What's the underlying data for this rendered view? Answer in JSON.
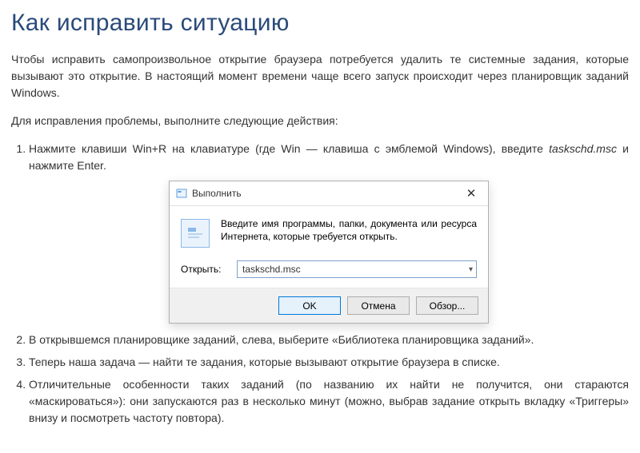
{
  "heading": "Как исправить ситуацию",
  "intro": "Чтобы исправить самопроизвольное открытие браузера потребуется удалить те системные задания, которые вызывают это открытие. В настоящий момент времени чаще всего запуск происходит через планировщик заданий Windows.",
  "lead": "Для исправления проблемы, выполните следующие действия:",
  "steps": {
    "s1a": "Нажмите клавиши Win+R на клавиатуре (где Win — клавиша с эмблемой Windows), введите ",
    "s1cmd": "taskschd.msc",
    "s1b": " и нажмите Enter.",
    "s2": "В открывшемся планировщике заданий, слева, выберите «Библиотека планировщика заданий».",
    "s3": "Теперь наша задача — найти те задания, которые вызывают открытие браузера в списке.",
    "s4": "Отличительные особенности таких заданий (по названию их найти не получится, они стараются «маскироваться»): они запускаются раз в несколько минут (можно, выбрав задание открыть вкладку «Триггеры» внизу и посмотреть частоту повтора)."
  },
  "run_dialog": {
    "title": "Выполнить",
    "instruction": "Введите имя программы, папки, документа или ресурса Интернета, которые требуется открыть.",
    "open_label": "Открыть:",
    "value": "taskschd.msc",
    "ok": "OK",
    "cancel": "Отмена",
    "browse": "Обзор..."
  }
}
